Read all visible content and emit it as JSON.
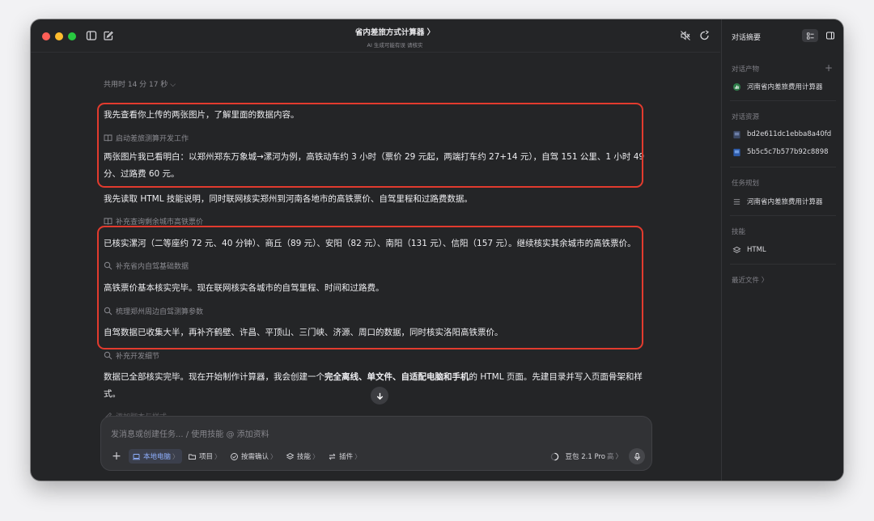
{
  "window": {
    "title": "省内差旅方式计算器 〉",
    "subtitle": "AI 生成可能有误 请核实"
  },
  "conversation": {
    "timer": "共用时 14 分 17 秒 ⌵",
    "messages": [
      {
        "kind": "text",
        "text": "我先查看你上传的两张图片，了解里面的数据内容。"
      },
      {
        "kind": "tool",
        "icon": "book-icon",
        "text": "启动差旅测算开发工作"
      },
      {
        "kind": "text",
        "text": "两张图片我已看明白：以郑州郑东万象城→漯河为例，高铁动车约 3 小时（票价 29 元起，两端打车约 27+14 元），自驾 151 公里、1 小时 49 分、过路费 60 元。"
      },
      {
        "kind": "text",
        "text": "我先读取 HTML 技能说明，同时联网核实郑州到河南各地市的高铁票价、自驾里程和过路费数据。"
      },
      {
        "kind": "tool",
        "icon": "book-icon",
        "text": "补充查询剩余城市高铁票价"
      },
      {
        "kind": "text",
        "text": "已核实漯河（二等座约 72 元、40 分钟）、商丘（89 元）、安阳（82 元）、南阳（131 元）、信阳（157 元）。继续核实其余城市的高铁票价。"
      },
      {
        "kind": "tool",
        "icon": "search-icon",
        "text": "补充省内自驾基础数据"
      },
      {
        "kind": "text",
        "text": "高铁票价基本核实完毕。现在联网核实各城市的自驾里程、时间和过路费。"
      },
      {
        "kind": "tool",
        "icon": "search-icon",
        "text": "梳理郑州周边自驾测算参数"
      },
      {
        "kind": "text",
        "text": "自驾数据已收集大半，再补齐鹤壁、许昌、平顶山、三门峡、济源、周口的数据，同时核实洛阳高铁票价。"
      },
      {
        "kind": "tool",
        "icon": "search-icon",
        "text": "补充开发细节"
      },
      {
        "kind": "text",
        "parts": [
          "数据已全部核实完毕。现在开始制作计算器，我会创建一个",
          "完全离线、单文件、自适配电脑和手机",
          "的 HTML 页面。先建目录并写入页面骨架和样式。"
        ]
      },
      {
        "kind": "tool",
        "icon": "pencil-icon",
        "text": "添加脚本与样式"
      }
    ]
  },
  "composer": {
    "placeholder": "发消息或创建任务... / 使用技能 @ 添加资料",
    "chips": [
      "本地电脑",
      "项目",
      "按需确认",
      "技能",
      "插件"
    ],
    "model": "豆包 2.1 Pro",
    "mode": "高"
  },
  "sidebar": {
    "title": "对话摘要",
    "sections": [
      {
        "label": "对话产物",
        "items": [
          {
            "icon": "chart-icon",
            "text": "河南省内差旅费用计算器"
          }
        ]
      },
      {
        "label": "对话资源",
        "items": [
          {
            "icon": "image-file-icon",
            "text": "bd2e611dc1ebba8a40fd"
          },
          {
            "icon": "image-file-icon",
            "text": "5b5c5c7b577b92c8898"
          }
        ]
      },
      {
        "label": "任务规划",
        "items": [
          {
            "icon": "list-icon",
            "text": "河南省内差旅费用计算器"
          }
        ]
      },
      {
        "label": "技能",
        "items": [
          {
            "icon": "stack-icon",
            "text": "HTML"
          }
        ]
      },
      {
        "label": "最近文件 〉",
        "items": []
      }
    ]
  },
  "annotation_color": "#e23b2e"
}
